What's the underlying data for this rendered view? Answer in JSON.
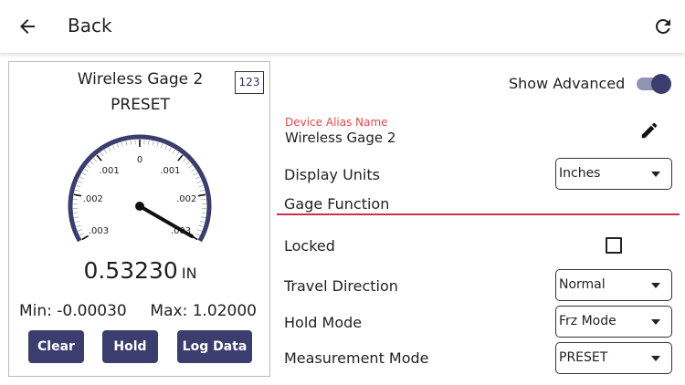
{
  "header": {
    "back_label": "Back",
    "icons": [
      "arrow-left-icon",
      "refresh-icon"
    ]
  },
  "gauge_card": {
    "device_name": "Wireless Gage 2",
    "mode": "PRESET",
    "keypad_label": "123",
    "dial_labels": [
      "0",
      ".001",
      ".002",
      ".003"
    ],
    "needle_value": 0.003,
    "reading": "0.53230",
    "unit": "IN",
    "min": "Min: -0.00030",
    "max": "Max: 1.02000",
    "buttons": {
      "clear": "Clear",
      "hold": "Hold",
      "log": "Log Data"
    }
  },
  "settings": {
    "show_advanced_label": "Show Advanced",
    "show_advanced_on": true,
    "alias_label": "Device Alias Name",
    "alias_value": "Wireless Gage 2",
    "display_units_label": "Display Units",
    "display_units_value": "Inches",
    "section_title": "Gage Function",
    "locked_label": "Locked",
    "locked_checked": false,
    "travel_direction_label": "Travel Direction",
    "travel_direction_value": "Normal",
    "hold_mode_label": "Hold Mode",
    "hold_mode_value": "Frz Mode",
    "measurement_mode_label": "Measurement Mode",
    "measurement_mode_value": "PRESET"
  },
  "colors": {
    "accent": "#3b3d6e",
    "alias_label": "#e0484d",
    "divider": "#c8334a"
  }
}
